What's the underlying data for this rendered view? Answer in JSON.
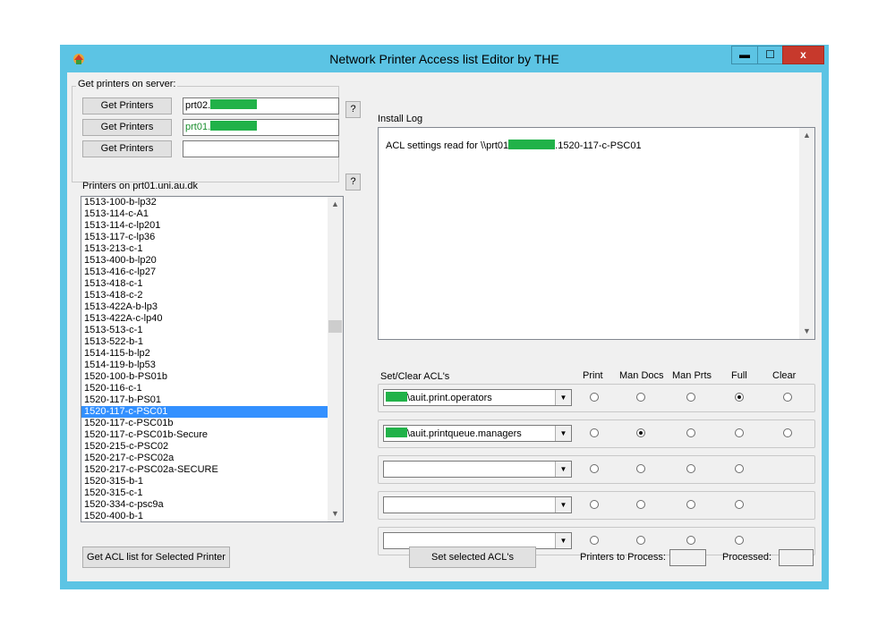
{
  "window": {
    "title": "Network Printer Access list Editor by THE",
    "app_icon": "printer-app-icon",
    "controls": {
      "minimize": "▬",
      "maximize": "☐",
      "close": "x"
    }
  },
  "server_group": {
    "legend": "Get printers on server:",
    "rows": [
      {
        "button": "Get Printers",
        "value": "prt02."
      },
      {
        "button": "Get Printers",
        "value": "prt01."
      },
      {
        "button": "Get Printers",
        "value": ""
      }
    ],
    "help_label": "?"
  },
  "printers": {
    "label": "Printers on  prt01.uni.au.dk",
    "help_label": "?",
    "selected": "1520-117-c-PSC01",
    "items": [
      "1513-100-b-lp32",
      "1513-114-c-A1",
      "1513-114-c-lp201",
      "1513-117-c-lp36",
      "1513-213-c-1",
      "1513-400-b-lp20",
      "1513-416-c-lp27",
      "1513-418-c-1",
      "1513-418-c-2",
      "1513-422A-b-lp3",
      "1513-422A-c-lp40",
      "1513-513-c-1",
      "1513-522-b-1",
      "1514-115-b-lp2",
      "1514-119-b-lp53",
      "1520-100-b-PS01b",
      "1520-116-c-1",
      "1520-117-b-PS01",
      "1520-117-c-PSC01",
      "1520-117-c-PSC01b",
      "1520-117-c-PSC01b-Secure",
      "1520-215-c-PSC02",
      "1520-217-c-PSC02a",
      "1520-217-c-PSC02a-SECURE",
      "1520-315-b-1",
      "1520-315-c-1",
      "1520-334-c-psc9a",
      "1520-400-b-1"
    ]
  },
  "install_log": {
    "label": "Install Log",
    "line_prefix": "ACL settings read for \\\\prt01",
    "line_suffix": ".1520-117-c-PSC01"
  },
  "acl": {
    "label": "Set/Clear ACL's",
    "columns": [
      "Print",
      "Man Docs",
      "Man Prts",
      "Full",
      "Clear"
    ],
    "rows": [
      {
        "group": "\\auit.print.operators",
        "masked": true,
        "selected": 3,
        "has_clear": true
      },
      {
        "group": "\\auit.printqueue.managers",
        "masked": true,
        "selected": 1,
        "has_clear": true
      },
      {
        "group": "",
        "masked": false,
        "selected": -1,
        "has_clear": false
      },
      {
        "group": "",
        "masked": false,
        "selected": -1,
        "has_clear": false
      },
      {
        "group": "",
        "masked": false,
        "selected": -1,
        "has_clear": false
      }
    ]
  },
  "footer": {
    "get_acl_button": "Get ACL list for Selected Printer",
    "set_acl_button": "Set selected ACL's",
    "printers_to_process_label": "Printers to Process:",
    "printers_to_process_value": "",
    "processed_label": "Processed:",
    "processed_value": ""
  },
  "colors": {
    "title_bar": "#5cc4e4",
    "close_button": "#c7392c",
    "redaction": "#21b249",
    "selection": "#3390ff"
  }
}
